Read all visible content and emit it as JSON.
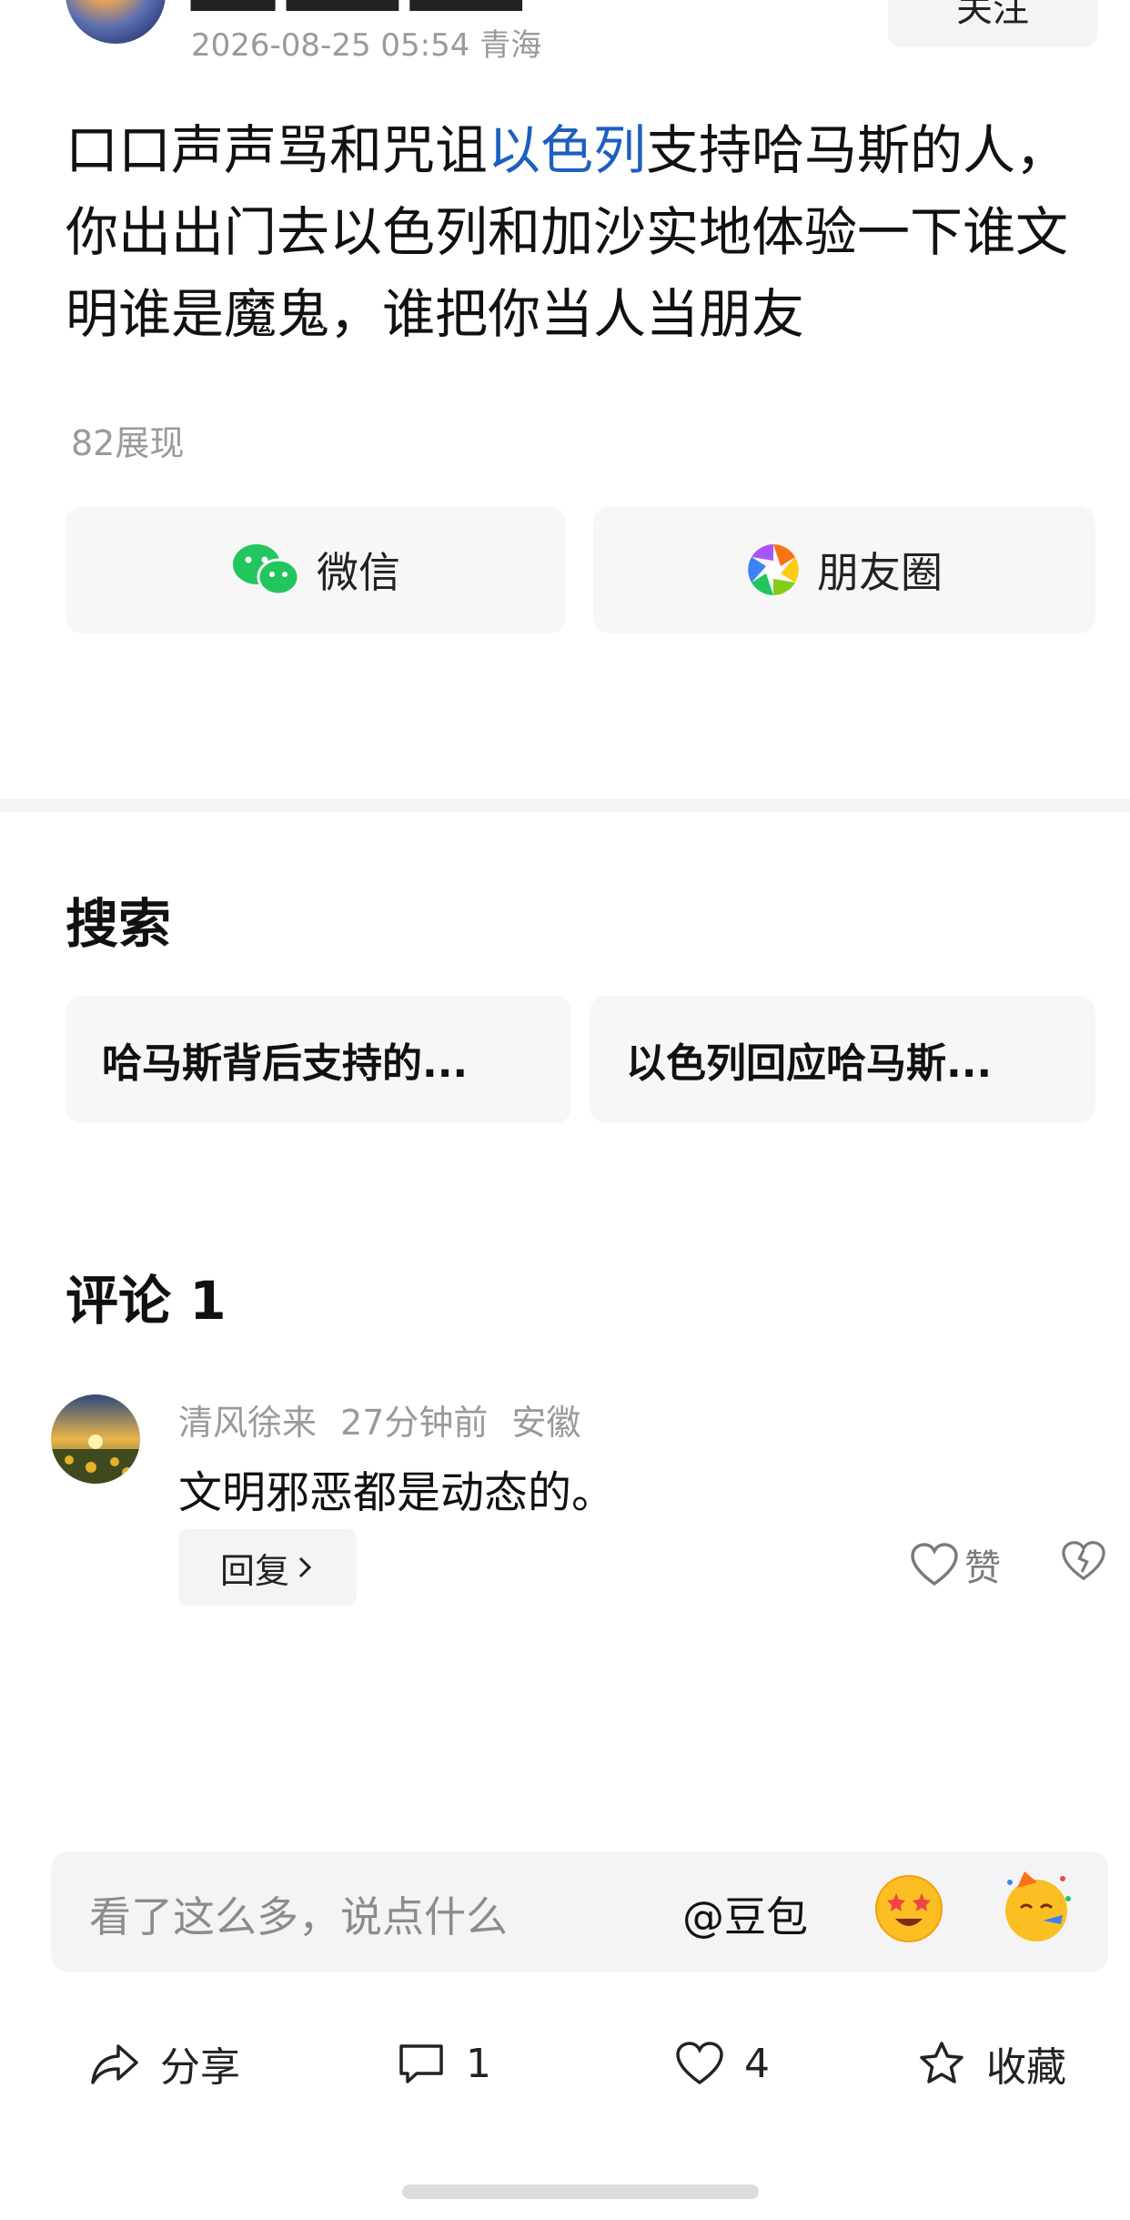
{
  "header": {
    "author_partial": "▆▆▆ ▆▆▆▆ ▆▆▆▆",
    "datetime": "2026-08-25 05:54",
    "location": "青海",
    "follow_label": "关注"
  },
  "post": {
    "text_before": "口口声声骂和咒诅",
    "link_text": "以色列",
    "text_after": "支持哈马斯的人，你出出门去以色列和加沙实地体验一下谁文明谁是魔鬼，谁把你当人当朋友",
    "views": "82展现"
  },
  "share": {
    "wechat_label": "微信",
    "moments_label": "朋友圈"
  },
  "search": {
    "title": "搜索",
    "items": [
      "哈马斯背后支持的...",
      "以色列回应哈马斯..."
    ]
  },
  "comments": {
    "title": "评论 1",
    "items": [
      {
        "user": "清风徐来",
        "time": "27分钟前",
        "location": "安徽",
        "text": "文明邪恶都是动态的。",
        "reply_label": "回复",
        "like_label": "赞"
      }
    ]
  },
  "input": {
    "placeholder": "看了这么多，说点什么",
    "at_label": "@豆包"
  },
  "bottom_bar": {
    "share_label": "分享",
    "comment_count": "1",
    "like_count": "4",
    "favorite_label": "收藏"
  },
  "colors": {
    "link": "#1d5fbf",
    "wechat_green": "#22c55e",
    "muted_text": "#9a9a9a"
  }
}
